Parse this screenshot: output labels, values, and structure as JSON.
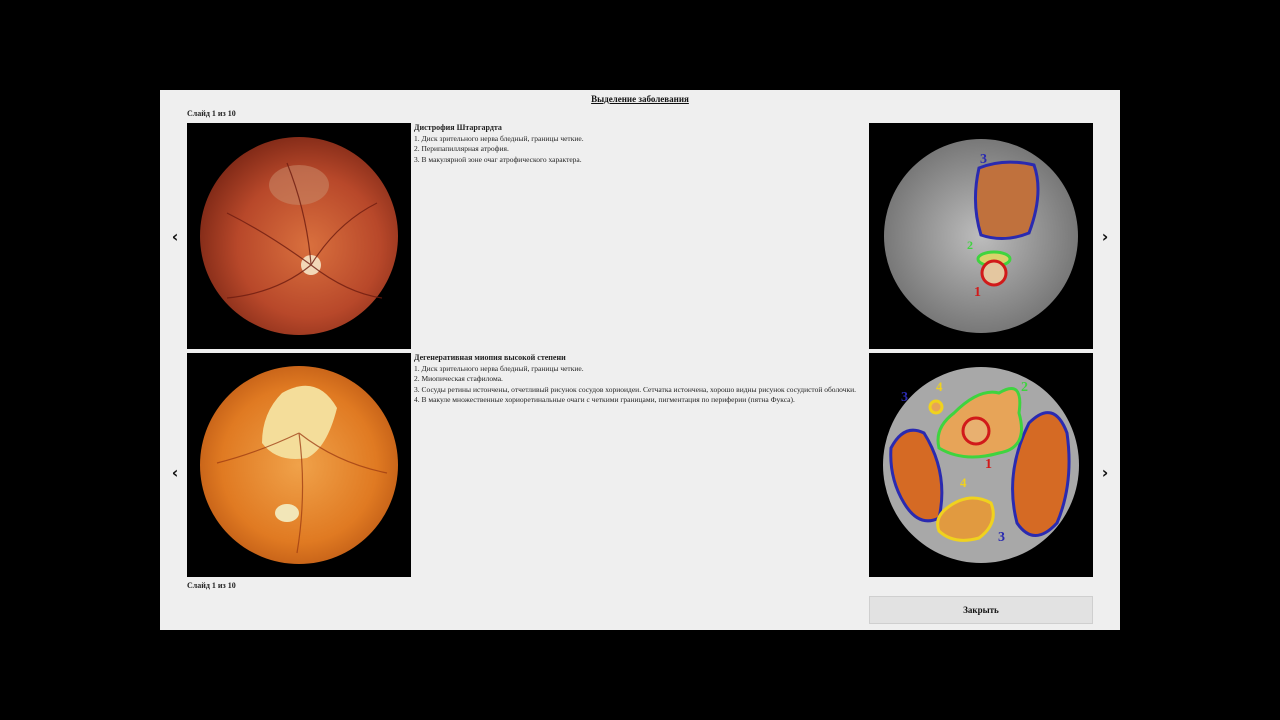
{
  "header": {
    "title": "Выделение заболевания"
  },
  "slides": {
    "counter_top": "Слайд 1 из 10",
    "counter_bottom": "Слайд 1 из 10"
  },
  "nav": {
    "prev_icon": "chevron-left-icon",
    "next_icon": "chevron-right-icon"
  },
  "cases": [
    {
      "title": "Дистрофия Штаргардта",
      "lines": [
        "1. Диск зрительного нерва бледный, границы четкие.",
        "2. Перипапиллярная атрофия.",
        "3. В макулярной зоне очаг атрофического характера."
      ],
      "markers": [
        "1",
        "2",
        "3"
      ]
    },
    {
      "title": "Дегенеративная миопия высокой степени",
      "lines": [
        "1. Диск зрительного нерва бледный, границы четкие.",
        "2. Миопическая стафилома.",
        "3. Сосуды ретины истончены, отчетливый рисунок сосудов хориоидеи. Сетчатка истончена, хорошо видны рисунок сосудистой оболочки.",
        "4. В макуле множественные хориоретинальные очаги с четкими границами, пигментация по периферии (пятна Фукса)."
      ],
      "markers": [
        "1",
        "2",
        "3",
        "3",
        "4",
        "4"
      ]
    }
  ],
  "button": {
    "label": "Закрыть"
  },
  "colors": {
    "backdrop": "#000000",
    "panel": "#efefef",
    "contour_red": "#d11a1a",
    "contour_green": "#3fd43f",
    "contour_blue": "#2a2ab0",
    "contour_yellow": "#f0d21e"
  }
}
